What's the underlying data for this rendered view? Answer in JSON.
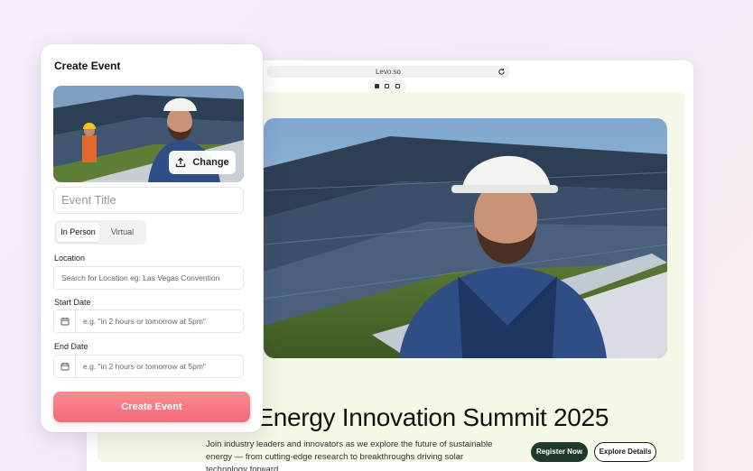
{
  "browser": {
    "url": "Levo.so",
    "hero": {
      "title": "Solar Energy Innovation Summit 2025",
      "description": "Join industry leaders and innovators as we explore the future of sustainable energy — from cutting-edge research to breakthroughs driving solar technology forward.",
      "register_label": "Register Now",
      "explore_label": "Explore Details"
    }
  },
  "card": {
    "title": "Create Event",
    "change_label": "Change",
    "title_placeholder": "Event Title",
    "toggle": {
      "options": [
        "In Person",
        "Virtual"
      ],
      "selected": "In Person"
    },
    "location": {
      "label": "Location",
      "placeholder": "Search for Location eg: Las Vegas Convention"
    },
    "start_date": {
      "label": "Start Date",
      "placeholder": "e.g. \"in 2 hours or tomorrow at 5pm\""
    },
    "end_date": {
      "label": "End Date",
      "placeholder": "e.g. \"in 2 hours or tomorrow at 5pm\""
    },
    "submit_label": "Create Event"
  },
  "colors": {
    "accent_gradient_start": "#fb8c8e",
    "accent_gradient_end": "#f36a7c",
    "register_button": "#1f3a2a",
    "hero_panel_bg": "#f4f8e6"
  }
}
